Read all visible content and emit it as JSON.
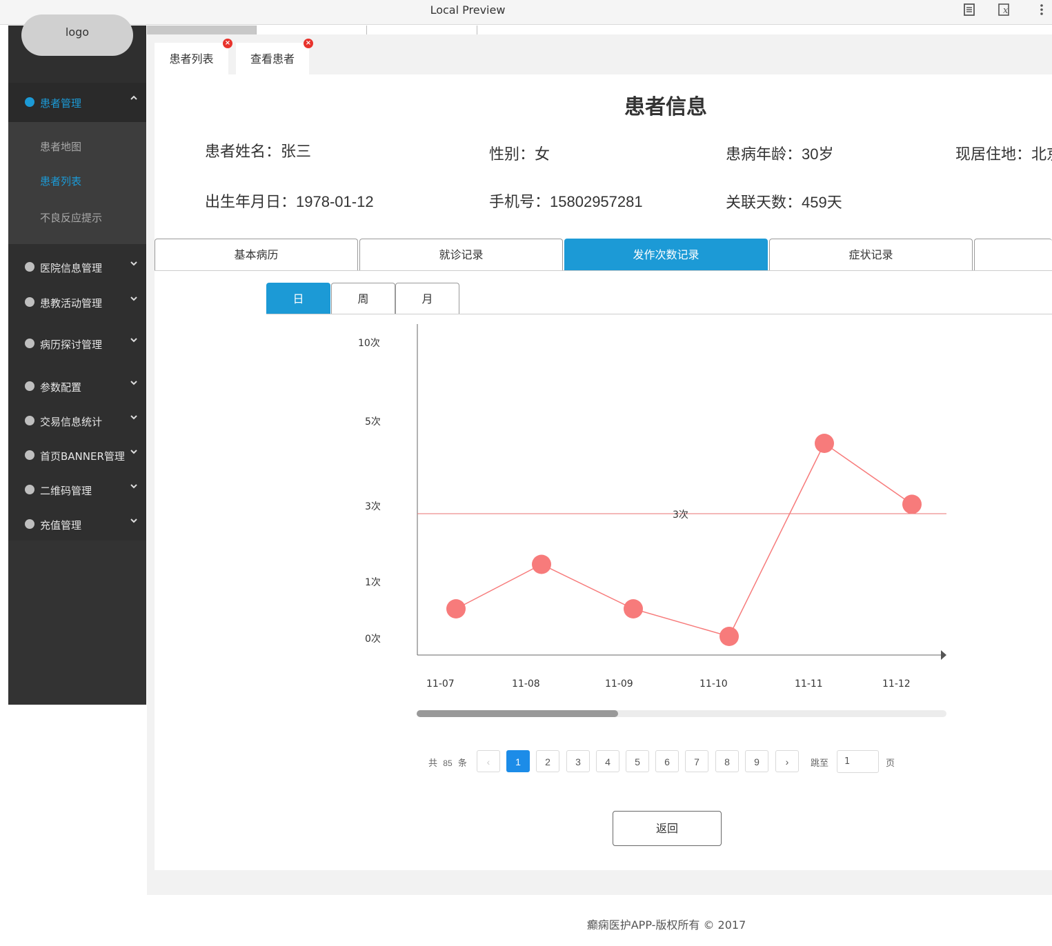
{
  "window": {
    "title": "Local Preview",
    "icons": [
      "reader-icon",
      "variable-icon",
      "more-icon"
    ]
  },
  "sidebar": {
    "logo": "logo",
    "active_group": {
      "label": "患者管理",
      "items": [
        {
          "label": "患者地图"
        },
        {
          "label": "患者列表"
        },
        {
          "label": "不良反应提示"
        }
      ]
    },
    "groups": [
      {
        "label": "医院信息管理"
      },
      {
        "label": "患教活动管理"
      },
      {
        "label": "病历探讨管理"
      },
      {
        "label": "参数配置"
      },
      {
        "label": "交易信息统计"
      },
      {
        "label": "首页BANNER管理"
      },
      {
        "label": "二维码管理"
      },
      {
        "label": "充值管理"
      }
    ]
  },
  "tabs": [
    {
      "label": "患者列表"
    },
    {
      "label": "查看患者"
    }
  ],
  "page": {
    "title": "患者信息",
    "fields": {
      "name_label": "患者姓名：",
      "name": "张三",
      "gender_label": "性别：",
      "gender": "女",
      "age_label": "患病年龄：",
      "age": "30岁",
      "address_label": "现居住地：",
      "address": "北京",
      "birth_label": "出生年月日：",
      "birth": "1978-01-12",
      "phone_label": "手机号：",
      "phone": "15802957281",
      "days_label": "关联天数：",
      "days": "459天"
    }
  },
  "record_tabs": [
    {
      "label": "基本病历"
    },
    {
      "label": "就诊记录"
    },
    {
      "label": "发作次数记录"
    },
    {
      "label": "症状记录"
    },
    {
      "label": ""
    }
  ],
  "period_tabs": [
    {
      "label": "日"
    },
    {
      "label": "周"
    },
    {
      "label": "月"
    }
  ],
  "chart_data": {
    "type": "line",
    "x": [
      "11-07",
      "11-08",
      "11-09",
      "11-10",
      "11-11",
      "11-12"
    ],
    "y_ticks": [
      "10次",
      "5次",
      "3次",
      "1次",
      "0次"
    ],
    "series": [
      {
        "values": [
          0.5,
          1.5,
          0.5,
          0,
          4.5,
          3.2
        ],
        "color": "#f77b7b"
      }
    ],
    "reference_line": {
      "value": 3,
      "label": "3次",
      "color": "#e87070"
    }
  },
  "pagination": {
    "total_prefix": "共",
    "total": "85",
    "total_suffix": "条",
    "prev": "‹",
    "next": "›",
    "pages": [
      "1",
      "2",
      "3",
      "4",
      "5",
      "6",
      "7",
      "8",
      "9"
    ],
    "current": "1",
    "jump_label": "跳至",
    "jump_value": "1",
    "jump_suffix": "页"
  },
  "back_button": "返回",
  "footer": "癫痫医护APP-版权所有 © 2017"
}
